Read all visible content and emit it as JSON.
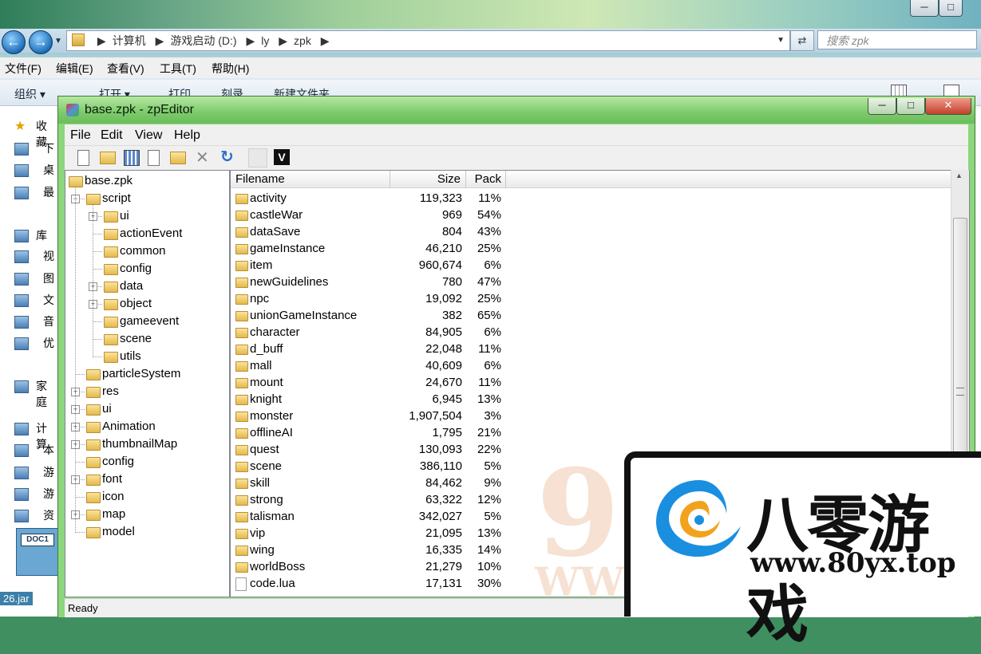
{
  "explorer": {
    "breadcrumb": [
      "计算机",
      "游戏启动 (D:)",
      "ly",
      "zpk"
    ],
    "search_placeholder": "搜索 zpk",
    "menu": [
      "文件(F)",
      "编辑(E)",
      "查看(V)",
      "工具(T)",
      "帮助(H)"
    ],
    "toolbar": [
      "组织 ▾",
      "打开 ▾",
      "打印",
      "刻录",
      "新建文件夹"
    ],
    "nav_items": [
      {
        "label": "收藏",
        "icon": "star-icon"
      },
      {
        "label": "下",
        "icon": "download-folder-icon"
      },
      {
        "label": "桌",
        "icon": "desktop-icon"
      },
      {
        "label": "最",
        "icon": "recent-places-icon"
      },
      {
        "label": "库",
        "icon": "library-icon"
      },
      {
        "label": "视",
        "icon": "video-library-icon"
      },
      {
        "label": "图",
        "icon": "picture-library-icon"
      },
      {
        "label": "文",
        "icon": "document-library-icon"
      },
      {
        "label": "音",
        "icon": "music-library-icon"
      },
      {
        "label": "优",
        "icon": "library-icon"
      },
      {
        "label": "家庭",
        "icon": "homegroup-icon"
      },
      {
        "label": "计算",
        "icon": "computer-icon"
      },
      {
        "label": "本",
        "icon": "drive-icon"
      },
      {
        "label": "游",
        "icon": "drive-icon"
      },
      {
        "label": "游",
        "icon": "drive-icon"
      },
      {
        "label": "资",
        "icon": "drive-icon"
      }
    ],
    "thumb_label": "DOC1",
    "jar_label": "26.jar"
  },
  "zp": {
    "title": "base.zpk - zpEditor",
    "menu": [
      "File",
      "Edit",
      "View",
      "Help"
    ],
    "view_badge": "V",
    "status": "Ready",
    "columns": {
      "name": "Filename",
      "size": "Size",
      "pack": "Pack"
    },
    "tree": [
      {
        "label": "base.zpk",
        "depth": 0,
        "expander": ""
      },
      {
        "label": "script",
        "depth": 1,
        "expander": "-"
      },
      {
        "label": "ui",
        "depth": 2,
        "expander": "+"
      },
      {
        "label": "actionEvent",
        "depth": 2,
        "expander": ""
      },
      {
        "label": "common",
        "depth": 2,
        "expander": ""
      },
      {
        "label": "config",
        "depth": 2,
        "expander": ""
      },
      {
        "label": "data",
        "depth": 2,
        "expander": "+"
      },
      {
        "label": "object",
        "depth": 2,
        "expander": "+"
      },
      {
        "label": "gameevent",
        "depth": 2,
        "expander": ""
      },
      {
        "label": "scene",
        "depth": 2,
        "expander": ""
      },
      {
        "label": "utils",
        "depth": 2,
        "expander": ""
      },
      {
        "label": "particleSystem",
        "depth": 1,
        "expander": ""
      },
      {
        "label": "res",
        "depth": 1,
        "expander": "+"
      },
      {
        "label": "ui",
        "depth": 1,
        "expander": "+"
      },
      {
        "label": "Animation",
        "depth": 1,
        "expander": "+"
      },
      {
        "label": "thumbnailMap",
        "depth": 1,
        "expander": "+"
      },
      {
        "label": "config",
        "depth": 1,
        "expander": ""
      },
      {
        "label": "font",
        "depth": 1,
        "expander": "+"
      },
      {
        "label": "icon",
        "depth": 1,
        "expander": ""
      },
      {
        "label": "map",
        "depth": 1,
        "expander": "+"
      },
      {
        "label": "model",
        "depth": 1,
        "expander": ""
      }
    ],
    "files": [
      {
        "name": "activity",
        "size": "119,323",
        "pack": "11%",
        "type": "folder"
      },
      {
        "name": "castleWar",
        "size": "969",
        "pack": "54%",
        "type": "folder"
      },
      {
        "name": "dataSave",
        "size": "804",
        "pack": "43%",
        "type": "folder"
      },
      {
        "name": "gameInstance",
        "size": "46,210",
        "pack": "25%",
        "type": "folder"
      },
      {
        "name": "item",
        "size": "960,674",
        "pack": "6%",
        "type": "folder"
      },
      {
        "name": "newGuidelines",
        "size": "780",
        "pack": "47%",
        "type": "folder"
      },
      {
        "name": "npc",
        "size": "19,092",
        "pack": "25%",
        "type": "folder"
      },
      {
        "name": "unionGameInstance",
        "size": "382",
        "pack": "65%",
        "type": "folder"
      },
      {
        "name": "character",
        "size": "84,905",
        "pack": "6%",
        "type": "folder"
      },
      {
        "name": "d_buff",
        "size": "22,048",
        "pack": "11%",
        "type": "folder"
      },
      {
        "name": "mall",
        "size": "40,609",
        "pack": "6%",
        "type": "folder"
      },
      {
        "name": "mount",
        "size": "24,670",
        "pack": "11%",
        "type": "folder"
      },
      {
        "name": "knight",
        "size": "6,945",
        "pack": "13%",
        "type": "folder"
      },
      {
        "name": "monster",
        "size": "1,907,504",
        "pack": "3%",
        "type": "folder"
      },
      {
        "name": "offlineAI",
        "size": "1,795",
        "pack": "21%",
        "type": "folder"
      },
      {
        "name": "quest",
        "size": "130,093",
        "pack": "22%",
        "type": "folder"
      },
      {
        "name": "scene",
        "size": "386,110",
        "pack": "5%",
        "type": "folder"
      },
      {
        "name": "skill",
        "size": "84,462",
        "pack": "9%",
        "type": "folder"
      },
      {
        "name": "strong",
        "size": "63,322",
        "pack": "12%",
        "type": "folder"
      },
      {
        "name": "talisman",
        "size": "342,027",
        "pack": "5%",
        "type": "folder"
      },
      {
        "name": "vip",
        "size": "21,095",
        "pack": "13%",
        "type": "folder"
      },
      {
        "name": "wing",
        "size": "16,335",
        "pack": "14%",
        "type": "folder"
      },
      {
        "name": "worldBoss",
        "size": "21,279",
        "pack": "10%",
        "type": "folder"
      },
      {
        "name": "code.lua",
        "size": "17,131",
        "pack": "30%",
        "type": "file"
      }
    ]
  },
  "watermark": {
    "digit": "9",
    "www": "WW",
    "brand_cn": "八零游戏",
    "brand_url": "www.80yx.top"
  },
  "colors": {
    "titlebar_green": "#7cca6a",
    "folder_yellow": "#e3b94c",
    "brand_blue": "#1a8fe0",
    "brand_orange": "#f2a21c"
  }
}
